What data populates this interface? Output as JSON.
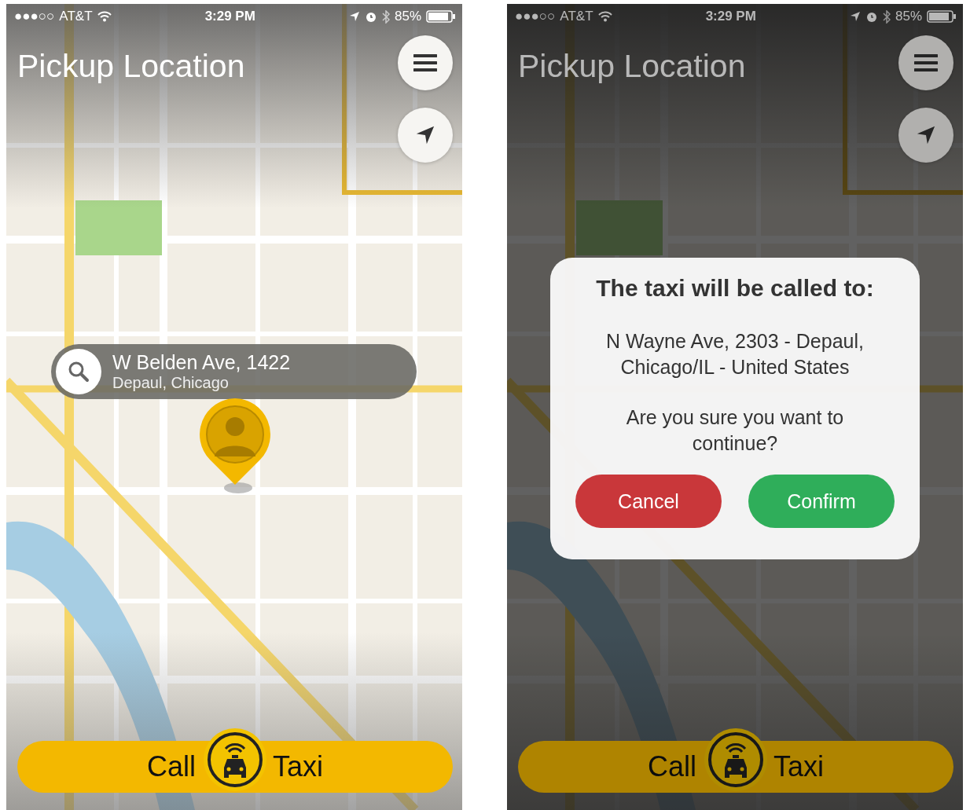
{
  "screens": [
    {
      "status_bar": {
        "signal": "●●●○○",
        "carrier": "AT&T",
        "time": "3:29 PM",
        "battery": "85%"
      },
      "title": "Pickup Location",
      "search": {
        "street": "W Belden Ave, 1422",
        "area": "Depaul, Chicago"
      },
      "call_button": {
        "left": "Call",
        "right": "Taxi"
      }
    },
    {
      "status_bar": {
        "signal": "●●●○○",
        "carrier": "AT&T",
        "time": "3:29 PM",
        "battery": "85%"
      },
      "title": "Pickup Location",
      "call_button": {
        "left": "Call",
        "right": "Taxi"
      },
      "dialog": {
        "title": "The taxi will be called to:",
        "address": "N Wayne Ave, 2303 - Depaul, Chicago/IL - United States",
        "question": "Are you sure you want to continue?",
        "cancel": "Cancel",
        "confirm": "Confirm"
      }
    }
  ]
}
